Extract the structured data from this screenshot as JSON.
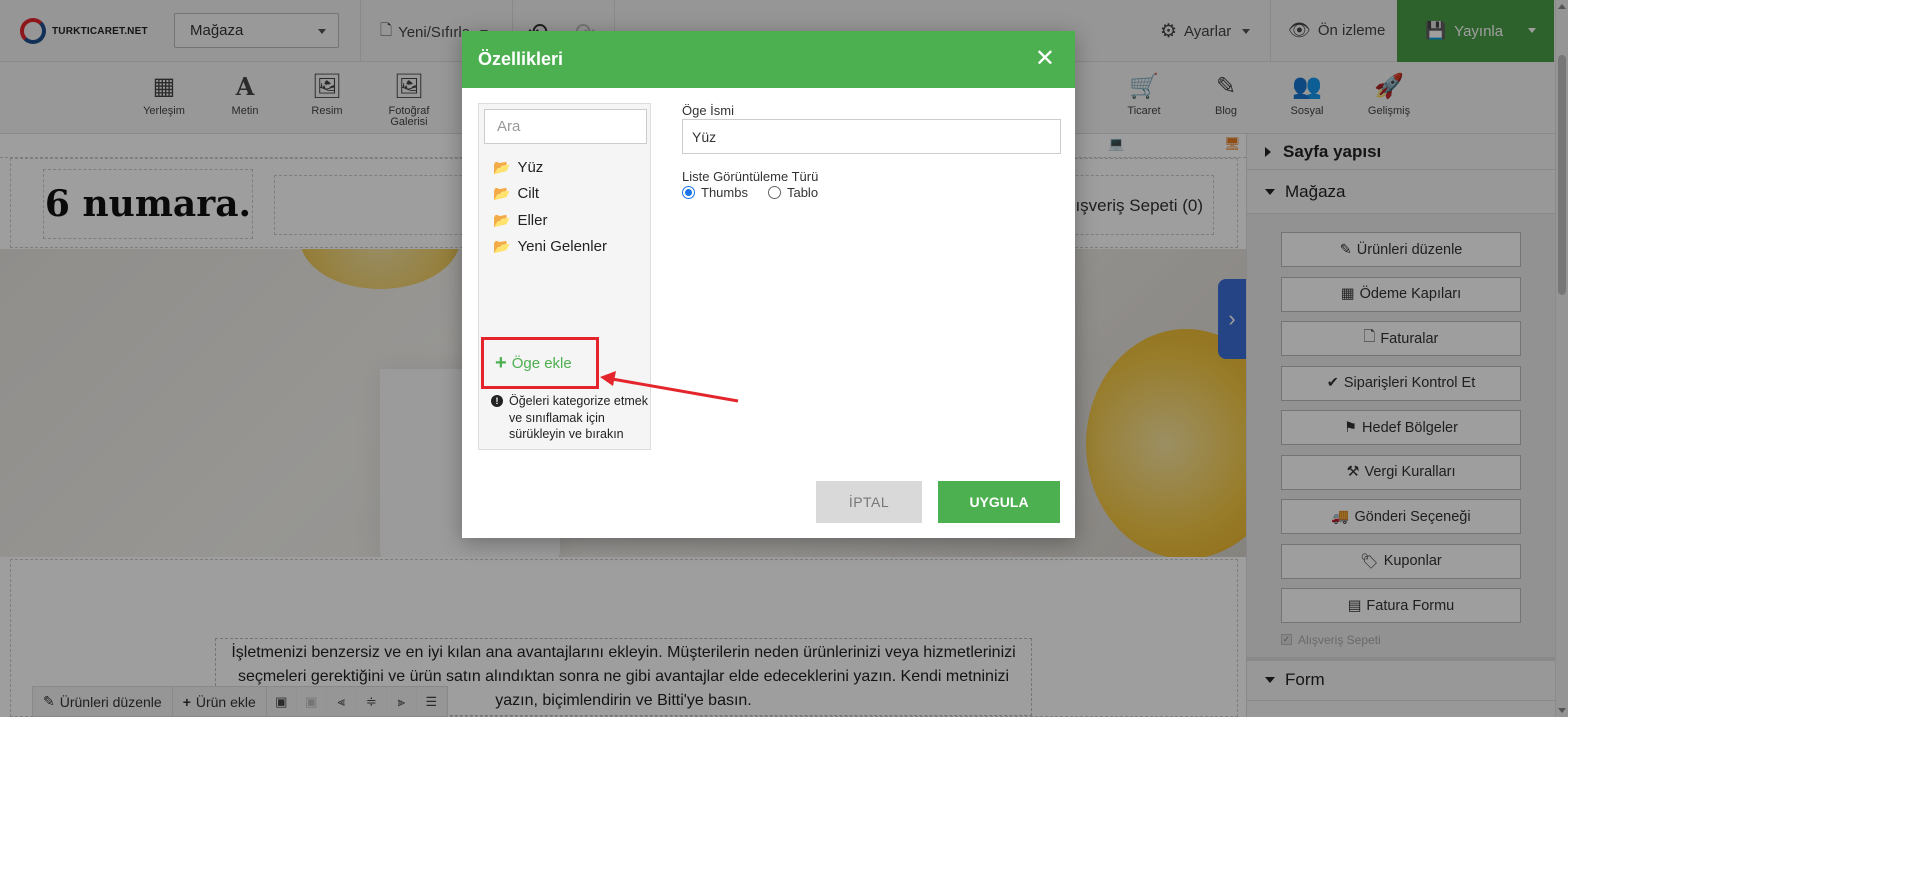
{
  "topbar": {
    "logo_text": "TURKTICARET.NET",
    "store_select": "Mağaza",
    "new_reset": "Yeni/Sıfırla",
    "settings": "Ayarlar",
    "preview": "Ön izleme",
    "publish": "Yayınla"
  },
  "toolbar": {
    "tools": [
      "Yerleşim",
      "Metin",
      "Resim",
      "Fotoğraf Galerisi",
      "Ticaret",
      "Blog",
      "Sosyal",
      "Gelişmiş"
    ]
  },
  "canvas": {
    "brand": "6 numara.",
    "cart": "Alışveriş Sepeti (0)",
    "description": "İşletmenizi benzersiz ve en iyi kılan ana avantajlarını ekleyin. Müşterilerin neden ürünlerinizi veya hizmetlerinizi seçmeleri gerektiğini ve ürün satın alındıktan sonra ne gibi avantajlar elde edeceklerini yazın. Kendi metninizi yazın, biçimlendirin ve Bitti'ye basın.",
    "bottom_tools": {
      "edit_products": "Ürünleri düzenle",
      "add_product": "Ürün ekle"
    }
  },
  "right_panel": {
    "page_structure": "Sayfa yapısı",
    "store": "Mağaza",
    "buttons": [
      "Ürünleri düzenle",
      "Ödeme Kapıları",
      "Faturalar",
      "Siparişleri Kontrol Et",
      "Hedef Bölgeler",
      "Vergi Kuralları",
      "Gönderi Seçeneği",
      "Kuponlar",
      "Fatura Formu"
    ],
    "cart_checkbox": "Alışveriş Sepeti",
    "form": "Form"
  },
  "modal": {
    "title": "Özellikleri",
    "search_placeholder": "Ara",
    "items": [
      "Yüz",
      "Cilt",
      "Eller",
      "Yeni Gelenler"
    ],
    "add_item": "Öge ekle",
    "hint": "Öğeleri kategorize etmek ve sınıflamak için sürükleyin ve bırakın",
    "item_name_label": "Öge İsmi",
    "item_name_value": "Yüz",
    "list_view_label": "Liste Görüntüleme Türü",
    "view_options": [
      "Thumbs",
      "Tablo"
    ],
    "selected_view": "Thumbs",
    "cancel": "İPTAL",
    "apply": "UYGULA"
  },
  "colors": {
    "accent_green": "#4caf50",
    "publish_green": "#4a9e49",
    "highlight_red": "#e4262c",
    "side_tab_blue": "#3a6fd8"
  }
}
